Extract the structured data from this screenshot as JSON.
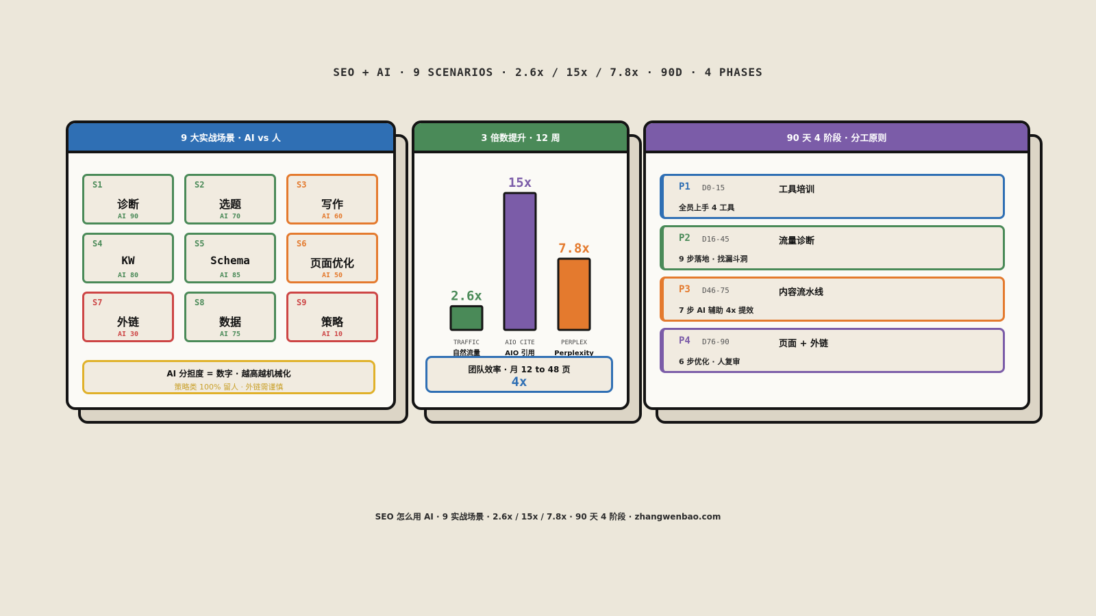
{
  "headline": "SEO + AI · 9 SCENARIOS · 2.6x / 15x / 7.8x · 90D · 4 PHASES",
  "footer": "SEO 怎么用 AI · 9 实战场景 · 2.6x / 15x / 7.8x · 90 天 4 阶段 · zhangwenbao.com",
  "colors": {
    "blue": "#2f6fb4",
    "green": "#4a8a58",
    "purple": "#7b5ca8",
    "orange": "#e47a2e",
    "red": "#cd4545",
    "yellow": "#e0b12a"
  },
  "scenarios": {
    "title": "9 大实战场景 · AI vs 人",
    "items": [
      {
        "code": "S1",
        "name": "诊断",
        "ai": "AI 90",
        "color": "#4a8a58"
      },
      {
        "code": "S2",
        "name": "选题",
        "ai": "AI 70",
        "color": "#4a8a58"
      },
      {
        "code": "S3",
        "name": "写作",
        "ai": "AI 60",
        "color": "#e47a2e"
      },
      {
        "code": "S4",
        "name": "KW",
        "ai": "AI 80",
        "color": "#4a8a58"
      },
      {
        "code": "S5",
        "name": "Schema",
        "ai": "AI 85",
        "color": "#4a8a58"
      },
      {
        "code": "S6",
        "name": "页面优化",
        "ai": "AI 50",
        "color": "#e47a2e"
      },
      {
        "code": "S7",
        "name": "外链",
        "ai": "AI 30",
        "color": "#cd4545"
      },
      {
        "code": "S8",
        "name": "数据",
        "ai": "AI 75",
        "color": "#4a8a58"
      },
      {
        "code": "S9",
        "name": "策略",
        "ai": "AI 10",
        "color": "#cd4545"
      }
    ],
    "note_line1": "AI 分担度 = 数字 · 越高越机械化",
    "note_line2": "策略类 100% 留人 · 外链需谨慎"
  },
  "growth": {
    "title": "3 倍数提升 · 12 周",
    "efficiency_label": "团队效率 · 月 12 to 48 页",
    "efficiency_value": "4x"
  },
  "chart_data": {
    "type": "bar",
    "title": "3 倍数提升 · 12 周",
    "categories": [
      "TRAFFIC",
      "AIO CITE",
      "PERPLEX"
    ],
    "category_sublabels": [
      "自然流量",
      "AIO 引用",
      "Perplexity"
    ],
    "values": [
      2.6,
      15,
      7.8
    ],
    "value_labels": [
      "2.6x",
      "15x",
      "7.8x"
    ],
    "colors": [
      "#4a8a58",
      "#7b5ca8",
      "#e47a2e"
    ],
    "ylim": [
      0,
      15
    ],
    "grid": false
  },
  "phases": {
    "title": "90 天 4 阶段 · 分工原则",
    "items": [
      {
        "id": "P1",
        "days": "D0-15",
        "title": "工具培训",
        "desc": "全员上手 4 工具",
        "color": "#2f6fb4"
      },
      {
        "id": "P2",
        "days": "D16-45",
        "title": "流量诊断",
        "desc": "9 步落地 · 找漏斗洞",
        "color": "#4a8a58"
      },
      {
        "id": "P3",
        "days": "D46-75",
        "title": "内容流水线",
        "desc": "7 步 AI 辅助 4x 提效",
        "color": "#e47a2e"
      },
      {
        "id": "P4",
        "days": "D76-90",
        "title": "页面 + 外链",
        "desc": "6 步优化 · 人复审",
        "color": "#7b5ca8"
      }
    ]
  }
}
